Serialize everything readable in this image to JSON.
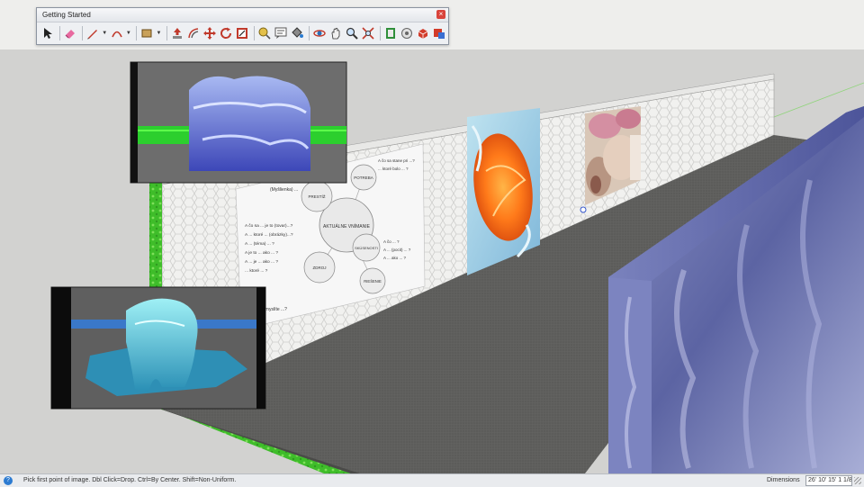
{
  "toolbar": {
    "title": "Getting Started",
    "tools": [
      {
        "icon": "select-arrow-icon",
        "name": "Select"
      },
      {
        "icon": "eraser-icon",
        "name": "Eraser"
      },
      {
        "icon": "pencil-line-icon",
        "name": "Line"
      },
      {
        "icon": "arc-icon",
        "name": "Arc"
      },
      {
        "icon": "rectangle-shape-icon",
        "name": "Rectangle"
      },
      {
        "icon": "push-pull-icon",
        "name": "Push/Pull"
      },
      {
        "icon": "offset-icon",
        "name": "Offset"
      },
      {
        "icon": "move-icon",
        "name": "Move"
      },
      {
        "icon": "rotate-icon",
        "name": "Rotate"
      },
      {
        "icon": "scale-icon",
        "name": "Scale"
      },
      {
        "icon": "tape-measure-icon",
        "name": "Tape Measure"
      },
      {
        "icon": "text-icon",
        "name": "Text"
      },
      {
        "icon": "paint-bucket-icon",
        "name": "Paint Bucket"
      },
      {
        "icon": "orbit-icon",
        "name": "Orbit"
      },
      {
        "icon": "pan-icon",
        "name": "Pan"
      },
      {
        "icon": "zoom-icon",
        "name": "Zoom"
      },
      {
        "icon": "zoom-extents-icon",
        "name": "Zoom Extents"
      },
      {
        "icon": "warehouse-icon",
        "name": "3D Warehouse"
      },
      {
        "icon": "extension-warehouse-icon",
        "name": "Extension Warehouse"
      },
      {
        "icon": "layout-icon",
        "name": "Send to LayOut"
      },
      {
        "icon": "extension-manager-icon",
        "name": "Extension Manager"
      }
    ]
  },
  "board": {
    "center": "AKTUÁLNE VNÍMANIE",
    "bubbles": [
      "PRESTÍŽ",
      "POTREBA",
      "ZDROJ",
      "SKÚSENOSTI",
      "RIEŠENIE"
    ],
    "left_lines": [
      "A čo sa ... je to (tovar)...?",
      "A ... ktoré ... (obrázky)...?",
      "A ... (téma) ... ?",
      "A je to ... ako ... ?",
      "A ... je ... ako ... ?",
      "... ktoré ... ?"
    ],
    "right_lines": [
      "A čo sa stane pri ...?",
      "... ktoré bolo ... ?",
      "A čo ... ?",
      "A ... (pocit) ... ?",
      "A ... ako ... ?"
    ],
    "top_left": "(Myšlienka) ...",
    "bottom_left": "A (ako) ... myslíte ...?"
  },
  "colors": {
    "sky": "#eeeeec",
    "ground": "#d2d2d0",
    "floor": "#5a5a58",
    "ground_trim": "#3fbd2a",
    "pillar": "#6f77b4"
  },
  "statusbar": {
    "message": "Pick first point of image. Dbl Click=Drop. Ctrl=By Center. Shift=Non-Uniform.",
    "measure_label": "Dimensions",
    "measure_value": "26' 10' 15' 1 1/8\""
  }
}
